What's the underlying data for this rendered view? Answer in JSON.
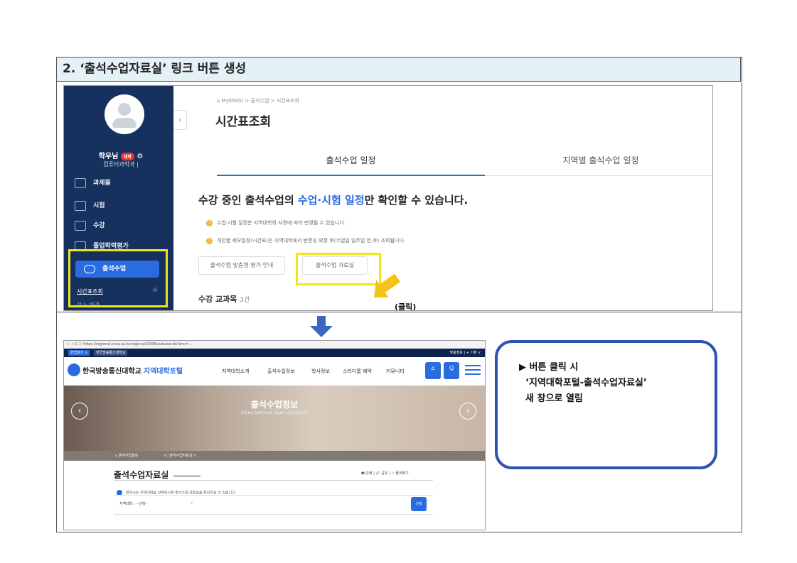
{
  "heading": "2. ‘출석수업자료실’ 링크 버튼 생성",
  "top_screenshot": {
    "user_name": "학우님",
    "badge": "재학",
    "department": "컴퓨터과학과 |",
    "menu": [
      "과제물",
      "시험",
      "수강",
      "졸업학력평가"
    ],
    "active_menu": "출석수업",
    "submenu_1": "시간표조회",
    "submenu_2": "장소 변경",
    "breadcrumb": "⌂ MyKNOU  >  출석수업  >  시간표조회",
    "page_title": "시간표조회",
    "tab_active": "출석수업 일정",
    "tab_other": "지역별 출석수업 일정",
    "headline_pre": "수강 중인 출석수업의 ",
    "headline_highlight": "수업·시험 일정",
    "headline_post": "만 확인할 수 있습니다.",
    "note_1": "수업·시험 일정은 지역대학의 사정에 따라 변경될 수 있습니다.",
    "note_2": "개인별 세부일정(시간표)은 지역대학에서 반편성 확정 후(수업일 일주일 전,후) 조회됩니다.",
    "button_1": "출석수업 맞춤형 평가 안내",
    "button_2": "출석수업 자료실",
    "click_label": "(클릭)",
    "course_count_label": "수강 교과목",
    "course_count_value": "3건"
  },
  "bottom_screenshot": {
    "url": "← → C  ⓘ https://regional.knou.ac.kr/regional/3396/subview.do?enc=...",
    "strip_tab_1": "현업정기 ↓",
    "strip_tab_2": "한국방송통신대학교",
    "strip_right": "맞춤정보  |  +  기본 ∨",
    "logo_name": "한국방송통신대학교",
    "logo_portal": "지역대학포털",
    "nav": [
      "지역대학소개",
      "출석수업정보",
      "학사정보",
      "스터디룸 예약",
      "커뮤니티"
    ],
    "nav_btn_1": "⌂",
    "nav_btn_2": "Q",
    "hero_title": "출석수업정보",
    "hero_subtitle": "Korea National Open University",
    "crumb_1": "⌂  출석수업정보",
    "crumb_2": "∨  |  출석수업자료실  ∨",
    "page_title": "출석수업자료실",
    "tools": "🖶 인쇄  |  🔗 공유  |  ☆ 즐겨찾기",
    "info": "원하시는 지역대학을 선택하시면 출석수업 자료실을 확인하실 수 있습니다.",
    "select_label": "지역대학 : --선택--",
    "select_button": "선택"
  },
  "callout": {
    "line_1": "▶ 버튼 클릭 시",
    "line_2": "  ‘지역대학포털-출석수업자료실’",
    "line_3": "  새 창으로 열림"
  },
  "colors": {
    "heading_bg": "#e4f1f6",
    "sidebar": "#17315f",
    "accent": "#2a6be0",
    "highlight_box": "#f0e61a",
    "callout_border": "#2f52b0"
  }
}
